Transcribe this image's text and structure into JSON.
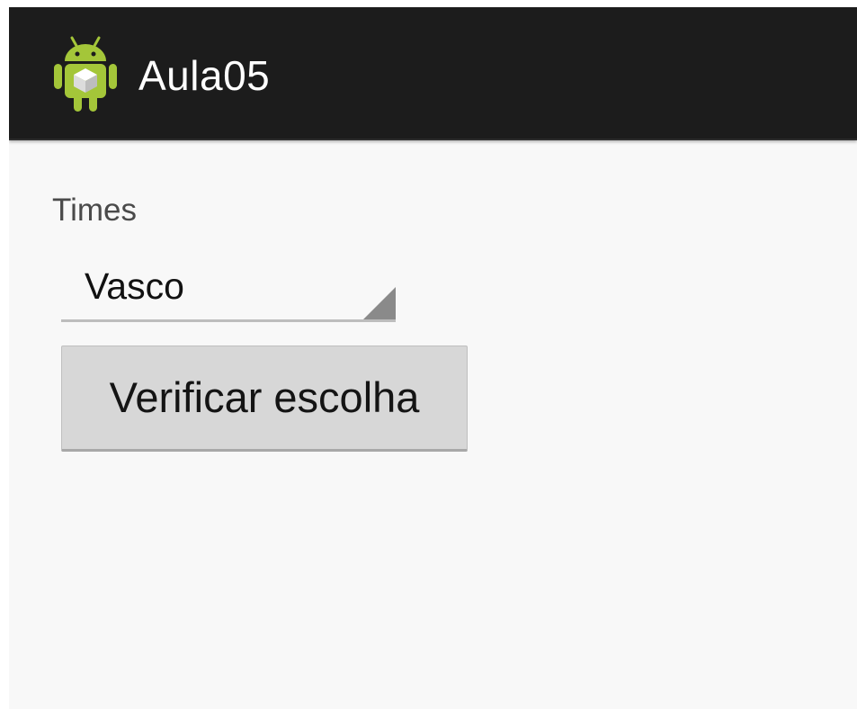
{
  "action_bar": {
    "title": "Aula05",
    "icon": "android-robot-icon",
    "background_color": "#1c1c1c"
  },
  "form": {
    "label": "Times",
    "spinner": {
      "selected_value": "Vasco",
      "icon": "spinner-corner-arrow-icon"
    },
    "button_label": "Verificar escolha"
  },
  "colors": {
    "android_green": "#a4c639",
    "content_background": "#f8f8f8",
    "button_background": "#d7d7d7"
  }
}
